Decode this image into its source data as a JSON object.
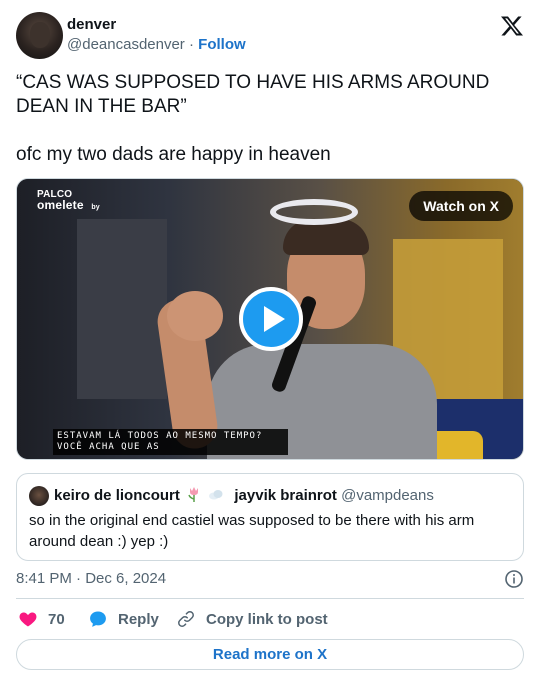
{
  "author": {
    "display_name": "denver",
    "handle": "@deancasdenver",
    "separator": "·",
    "follow_label": "Follow"
  },
  "tweet": {
    "text_line1": "“CAS WAS SUPPOSED TO HAVE HIS ARMS AROUND DEAN IN THE BAR”",
    "text_line2": "ofc my two dads are happy in heaven"
  },
  "video": {
    "brand_top": "PALCO",
    "brand_bottom": "omelete",
    "brand_by": "by",
    "watch_label": "Watch on X",
    "caption_line1": "ESTAVAM LÁ TODOS AO MESMO TEMPO?",
    "caption_line2": "VOCÊ ACHA QUE AS"
  },
  "quote": {
    "name": "keiro de lioncourt",
    "name2": "jayvik brainrot",
    "handle": "@vampdeans",
    "text": "so in the original end castiel was supposed to be there with his arm around dean :) yep :)"
  },
  "meta": {
    "timestamp": "8:41 PM · Dec 6, 2024"
  },
  "actions": {
    "like_count": "70",
    "reply_label": "Reply",
    "copy_label": "Copy link to post"
  },
  "footer": {
    "read_more_label": "Read more on X"
  },
  "colors": {
    "link_blue": "#1d73c9",
    "play_blue": "#1d9bf0",
    "heart_red": "#f91880",
    "muted": "#536471"
  }
}
